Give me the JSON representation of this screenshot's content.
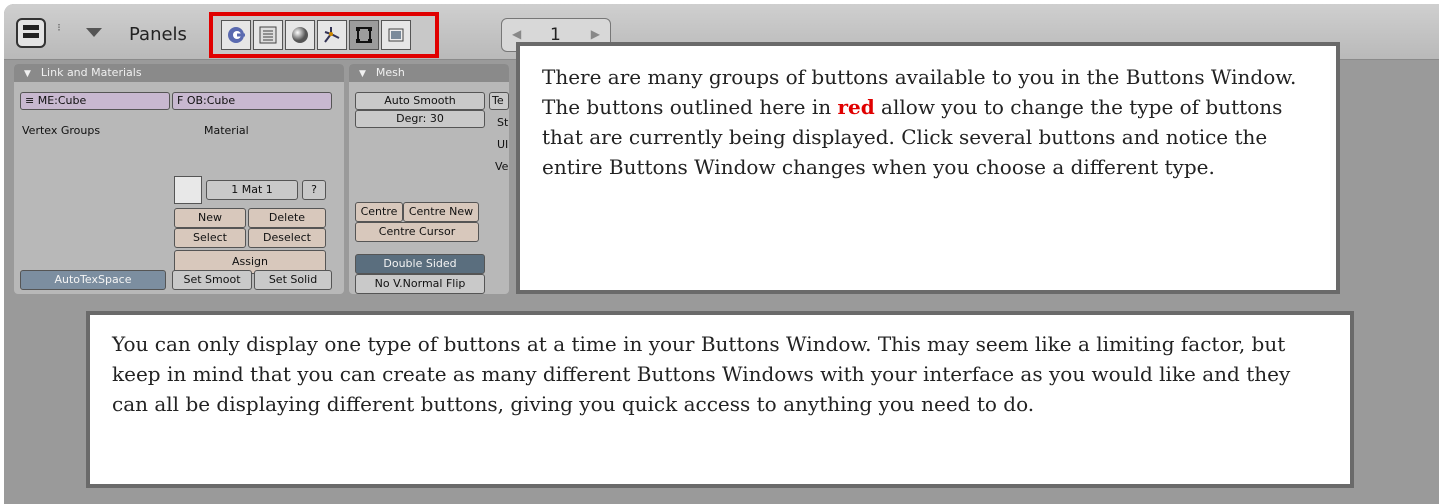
{
  "header": {
    "label": "Panels",
    "page_value": "1",
    "stepper_glyph": "⁝",
    "arrow_left": "◀",
    "arrow_right": "▶",
    "button_types": [
      {
        "icon": "logic-icon"
      },
      {
        "icon": "script-icon"
      },
      {
        "icon": "shading-icon"
      },
      {
        "icon": "object-icon"
      },
      {
        "icon": "editing-icon",
        "active": true
      },
      {
        "icon": "scene-icon"
      }
    ],
    "highlight_color": "#e00000"
  },
  "panels": {
    "link_materials": {
      "title": "Link and Materials",
      "mesh_field": "ME:Cube",
      "mesh_field_prefix": "≡",
      "object_field_prefix": "F",
      "object_field": "OB:Cube",
      "vertex_groups_label": "Vertex Groups",
      "material_label": "Material",
      "material_value": "1 Mat 1",
      "material_help": "?",
      "buttons": [
        "New",
        "Delete",
        "Select",
        "Deselect",
        "Assign"
      ],
      "autotexspace": "AutoTexSpace",
      "set_smooth": "Set Smoot",
      "set_solid": "Set Solid"
    },
    "mesh": {
      "title": "Mesh",
      "auto_smooth": "Auto Smooth",
      "degr": "Degr: 30",
      "centre": "Centre",
      "centre_new": "Centre New",
      "centre_cursor": "Centre Cursor",
      "double_sided": "Double Sided",
      "no_normal_flip": "No V.Normal Flip",
      "partial_labels": [
        "Te",
        "St",
        "UI",
        "Ve"
      ]
    }
  },
  "callouts": {
    "first_before": "There are many groups of buttons available to you in the Buttons Window. The buttons outlined here in ",
    "first_red": "red",
    "first_after": " allow you to change the type of buttons that are currently being displayed. Click several buttons and notice the entire Buttons Window changes when you choose a different type.",
    "second": "You can only display one type of buttons at a time in your Buttons Window. This may seem like a limiting factor, but keep in mind that you can create as many different Buttons Windows with your interface as you would like and they can all be displaying different buttons, giving you quick access to anything you need to do."
  }
}
